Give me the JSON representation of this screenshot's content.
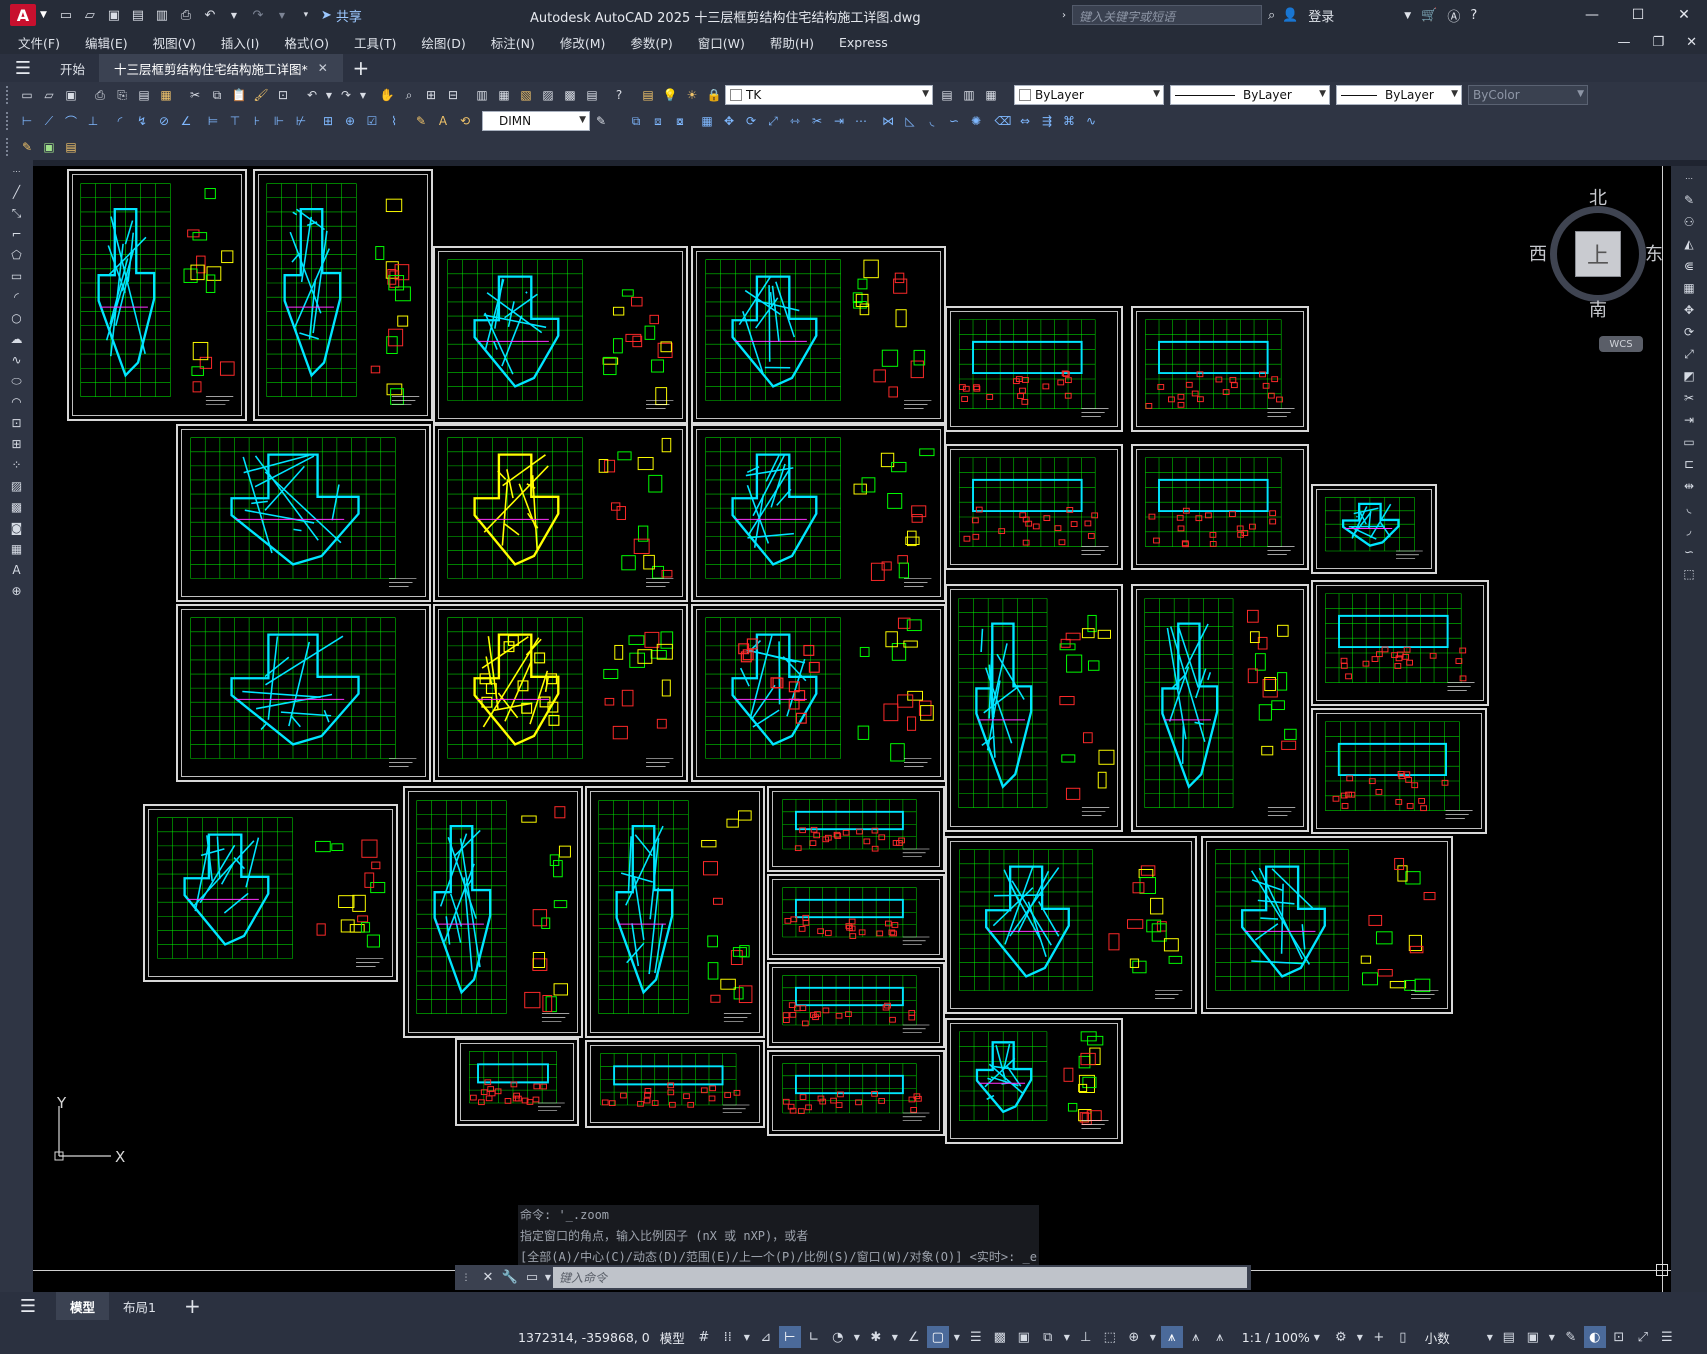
{
  "titlebar": {
    "logo": "A",
    "share_label": "共享",
    "title": "Autodesk AutoCAD 2025    十三层框剪结构住宅结构施工详图.dwg",
    "search_placeholder": "键入关键字或短语",
    "signin_label": "登录",
    "icons": [
      "new-icon",
      "open-icon",
      "save-icon",
      "saveas-icon",
      "web-icon",
      "plot-icon",
      "undo-icon",
      "redo-icon"
    ]
  },
  "menu": {
    "items": [
      "文件(F)",
      "编辑(E)",
      "视图(V)",
      "插入(I)",
      "格式(O)",
      "工具(T)",
      "绘图(D)",
      "标注(N)",
      "修改(M)",
      "参数(P)",
      "窗口(W)",
      "帮助(H)",
      "Express"
    ]
  },
  "tabs": {
    "start_label": "开始",
    "active_label": "十三层框剪结构住宅结构施工详图*"
  },
  "toolbar": {
    "layer_name": "TK",
    "color": "ByLayer",
    "linetype": "ByLayer",
    "lineweight": "ByLayer",
    "plotstyle": "ByColor",
    "dimstyle": "DIMN"
  },
  "viewcube": {
    "north": "北",
    "south": "南",
    "east": "东",
    "west": "西",
    "face": "上",
    "wcs": "WCS"
  },
  "ucs": {
    "x": "X",
    "y": "Y"
  },
  "command": {
    "history": [
      "命令: '_.zoom",
      "指定窗口的角点，输入比例因子 (nX 或 nXP)，或者",
      "[全部(A)/中心(C)/动态(D)/范围(E)/上一个(P)/比例(S)/窗口(W)/对象(O)] <实时>: _e"
    ],
    "placeholder": "键入命令"
  },
  "layout_tabs": {
    "model": "模型",
    "layout1": "布局1"
  },
  "status": {
    "coords": "1372314, -359868, 0",
    "model": "模型",
    "scale": "1:1 / 100%",
    "units": "小数"
  },
  "colors": {
    "canvas": "#000000",
    "accent_green": "#00ff00",
    "accent_cyan": "#00e5ff",
    "accent_yellow": "#ffff00",
    "accent_red": "#ff2a2a",
    "accent_magenta": "#ff33ff"
  }
}
